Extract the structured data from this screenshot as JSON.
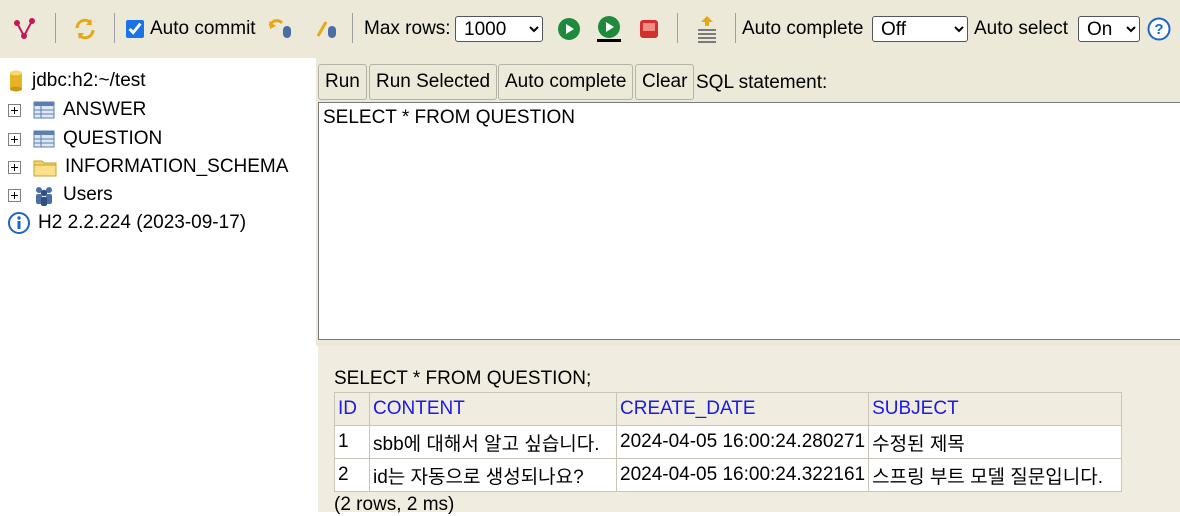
{
  "toolbar": {
    "auto_commit_label": "Auto commit",
    "max_rows_label": "Max rows:",
    "max_rows_value": "1000",
    "auto_complete_label": "Auto complete",
    "auto_complete_value": "Off",
    "auto_select_label": "Auto select",
    "auto_select_value": "On"
  },
  "tree": {
    "connection": "jdbc:h2:~/test",
    "items": [
      {
        "label": "ANSWER"
      },
      {
        "label": "QUESTION"
      },
      {
        "label": "INFORMATION_SCHEMA"
      },
      {
        "label": "Users"
      }
    ],
    "version": "H2 2.2.224 (2023-09-17)"
  },
  "query": {
    "run": "Run",
    "run_selected": "Run Selected",
    "auto_complete": "Auto complete",
    "clear": "Clear",
    "sql_label": "SQL statement:",
    "sql_text": "SELECT * FROM QUESTION"
  },
  "results": {
    "statement": "SELECT * FROM QUESTION;",
    "columns": [
      "ID",
      "CONTENT",
      "CREATE_DATE",
      "SUBJECT"
    ],
    "rows": [
      [
        "1",
        "sbb에 대해서 알고 싶습니다.",
        "2024-04-05 16:00:24.280271",
        "수정된 제목"
      ],
      [
        "2",
        "id는 자동으로 생성되나요?",
        "2024-04-05 16:00:24.322161",
        "스프링 부트 모델 질문입니다."
      ]
    ],
    "footer": "(2 rows, 2 ms)"
  },
  "colors": {
    "toolbar_bg": "#ece9d8",
    "header_text": "#1a1ae6",
    "run_icon": "#1e8a3c",
    "stop_icon": "#d32f2f"
  }
}
